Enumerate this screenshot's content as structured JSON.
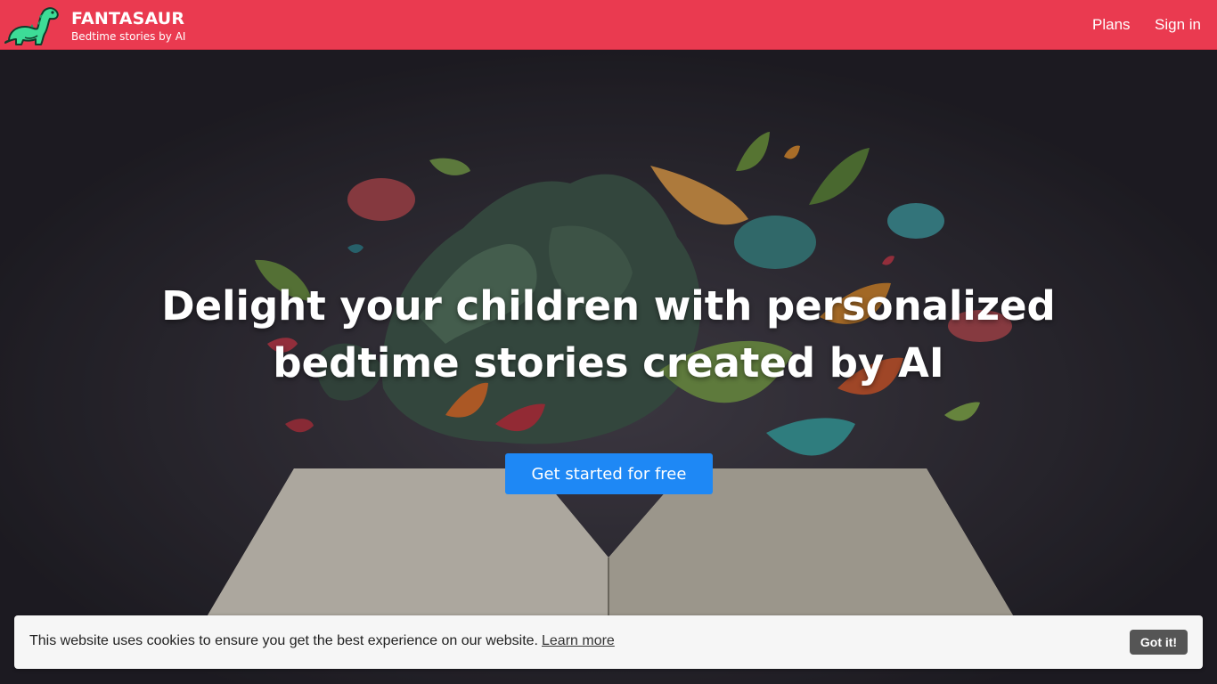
{
  "header": {
    "brand_name": "FANTASAUR",
    "brand_tagline": "Bedtime stories by AI",
    "logo_icon": "dinosaur-icon",
    "nav": [
      {
        "label": "Plans"
      },
      {
        "label": "Sign in"
      }
    ],
    "background_color": "#ea3a50"
  },
  "hero": {
    "title_line1": "Delight your children with personalized",
    "title_line2": "bedtime stories created by AI",
    "cta_label": "Get started for free",
    "cta_color": "#1e88f5",
    "background_image": "open-book-with-paper-leaves-and-brain-shapes"
  },
  "cookie_banner": {
    "message": "This website uses cookies to ensure you get the best experience on our website.",
    "learn_more_label": "Learn more",
    "accept_label": "Got it!"
  }
}
